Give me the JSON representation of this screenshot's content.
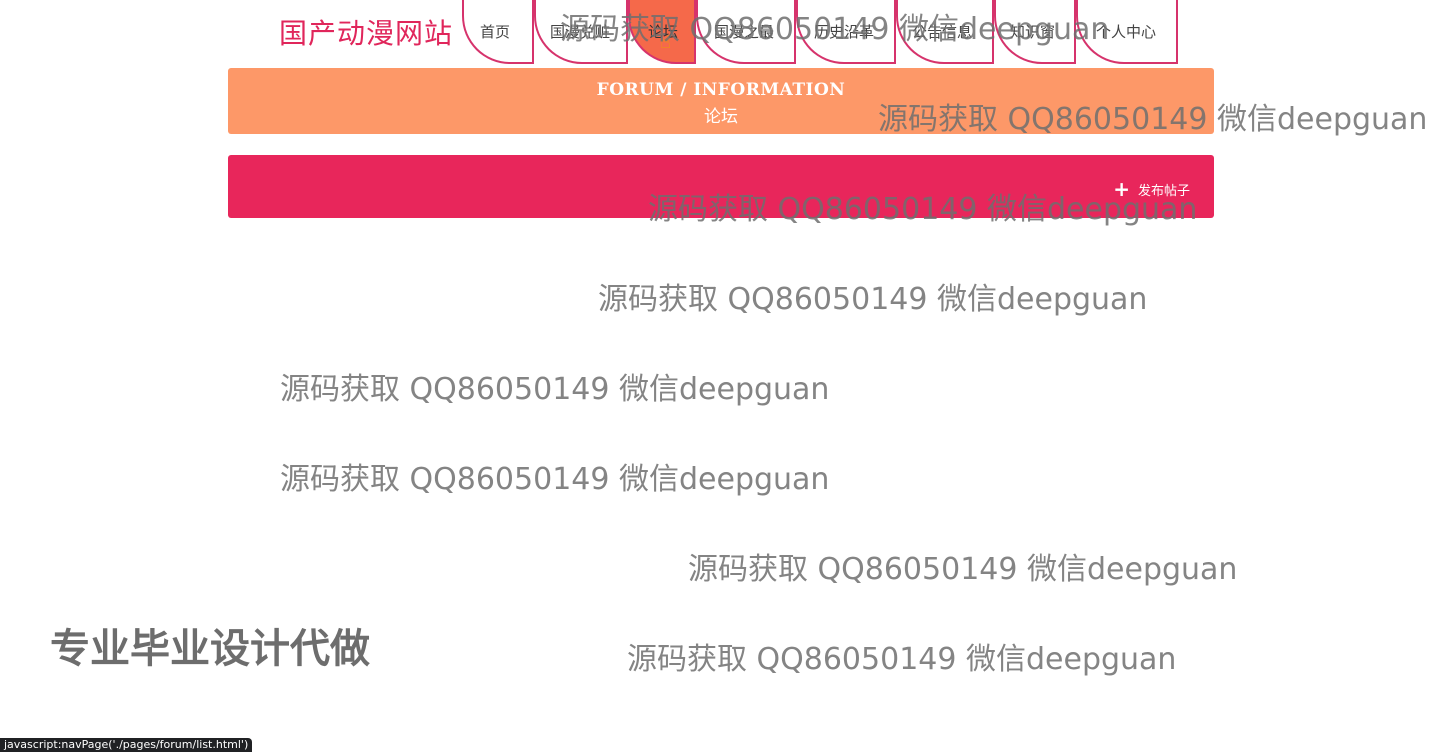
{
  "logo": "国产动漫网站",
  "nav": {
    "items": [
      {
        "label": "首页"
      },
      {
        "label": "国漫兑赃"
      },
      {
        "label": "论坛"
      },
      {
        "label": "国漫之最"
      },
      {
        "label": "历史沿革"
      },
      {
        "label": "公告信息"
      },
      {
        "label": "知识窗"
      },
      {
        "label": "个人中心"
      }
    ]
  },
  "banner": {
    "title": "FORUM / INFORMATION",
    "subtitle": "论坛"
  },
  "actions": {
    "publish_label": "发布帖子"
  },
  "watermarks": [
    "源码获取 QQ86050149 微信deepguan",
    "源码获取 QQ86050149 微信deepguan",
    "源码获取 QQ86050149 微信deepguan",
    "源码获取 QQ86050149 微信deepguan",
    "源码获取 QQ86050149 微信deepguan",
    "源码获取 QQ86050149 微信deepguan",
    "源码获取 QQ86050149 微信deepguan",
    "源码获取 QQ86050149 微信deepguan"
  ],
  "overlay_text": "专业毕业设计代做",
  "status_url": "javascript:navPage('./pages/forum/list.html')",
  "colors": {
    "brand": "#e0265b",
    "banner": "#fd9868",
    "bar": "#e8265b",
    "active_tab": "#f5694a"
  },
  "icons": {
    "cursor": "hand-pointer-icon",
    "publish": "plus-icon"
  }
}
